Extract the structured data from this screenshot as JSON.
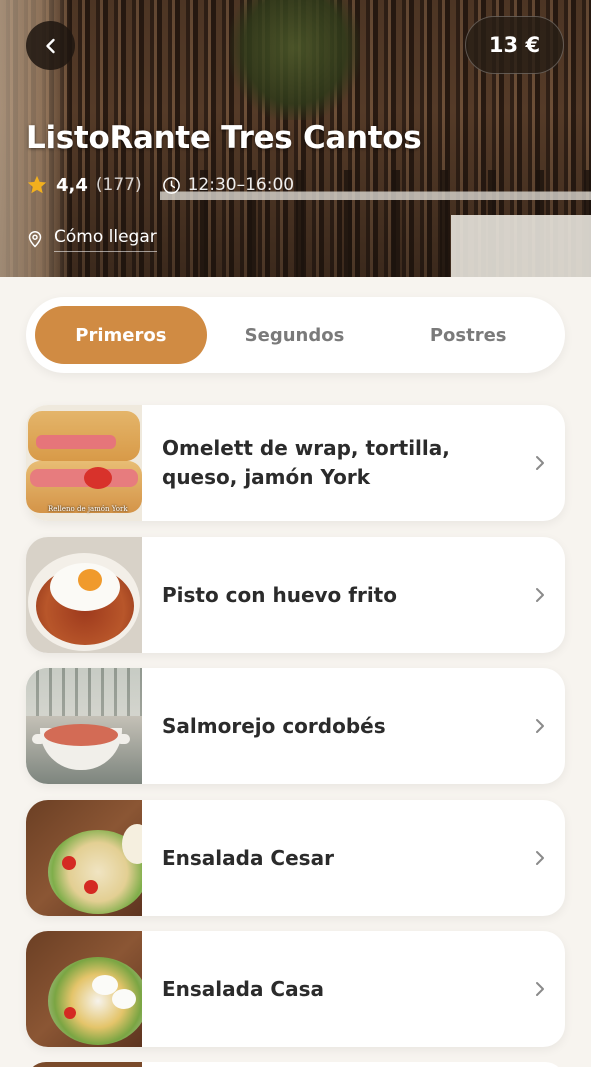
{
  "header": {
    "back_icon": "chevron-left-icon",
    "price": "13 €",
    "restaurant_name": "ListoRante Tres Cantos",
    "rating": "4,4",
    "reviews": "(177)",
    "hours": "12:30–16:00",
    "directions_label": "Cómo llegar"
  },
  "tabs": [
    {
      "label": "Primeros",
      "active": true
    },
    {
      "label": "Segundos",
      "active": false
    },
    {
      "label": "Postres",
      "active": false
    }
  ],
  "dishes": [
    {
      "name": "Omelett de wrap, tortilla, queso, jamón York",
      "thumb_caption": "Relleno de jamón York"
    },
    {
      "name": "Pisto con huevo frito"
    },
    {
      "name": "Salmorejo cordobés"
    },
    {
      "name": "Ensalada Cesar"
    },
    {
      "name": "Ensalada Casa"
    }
  ],
  "colors": {
    "accent": "#d08b43",
    "background": "#f7f4ef",
    "star": "#f2b01e"
  }
}
